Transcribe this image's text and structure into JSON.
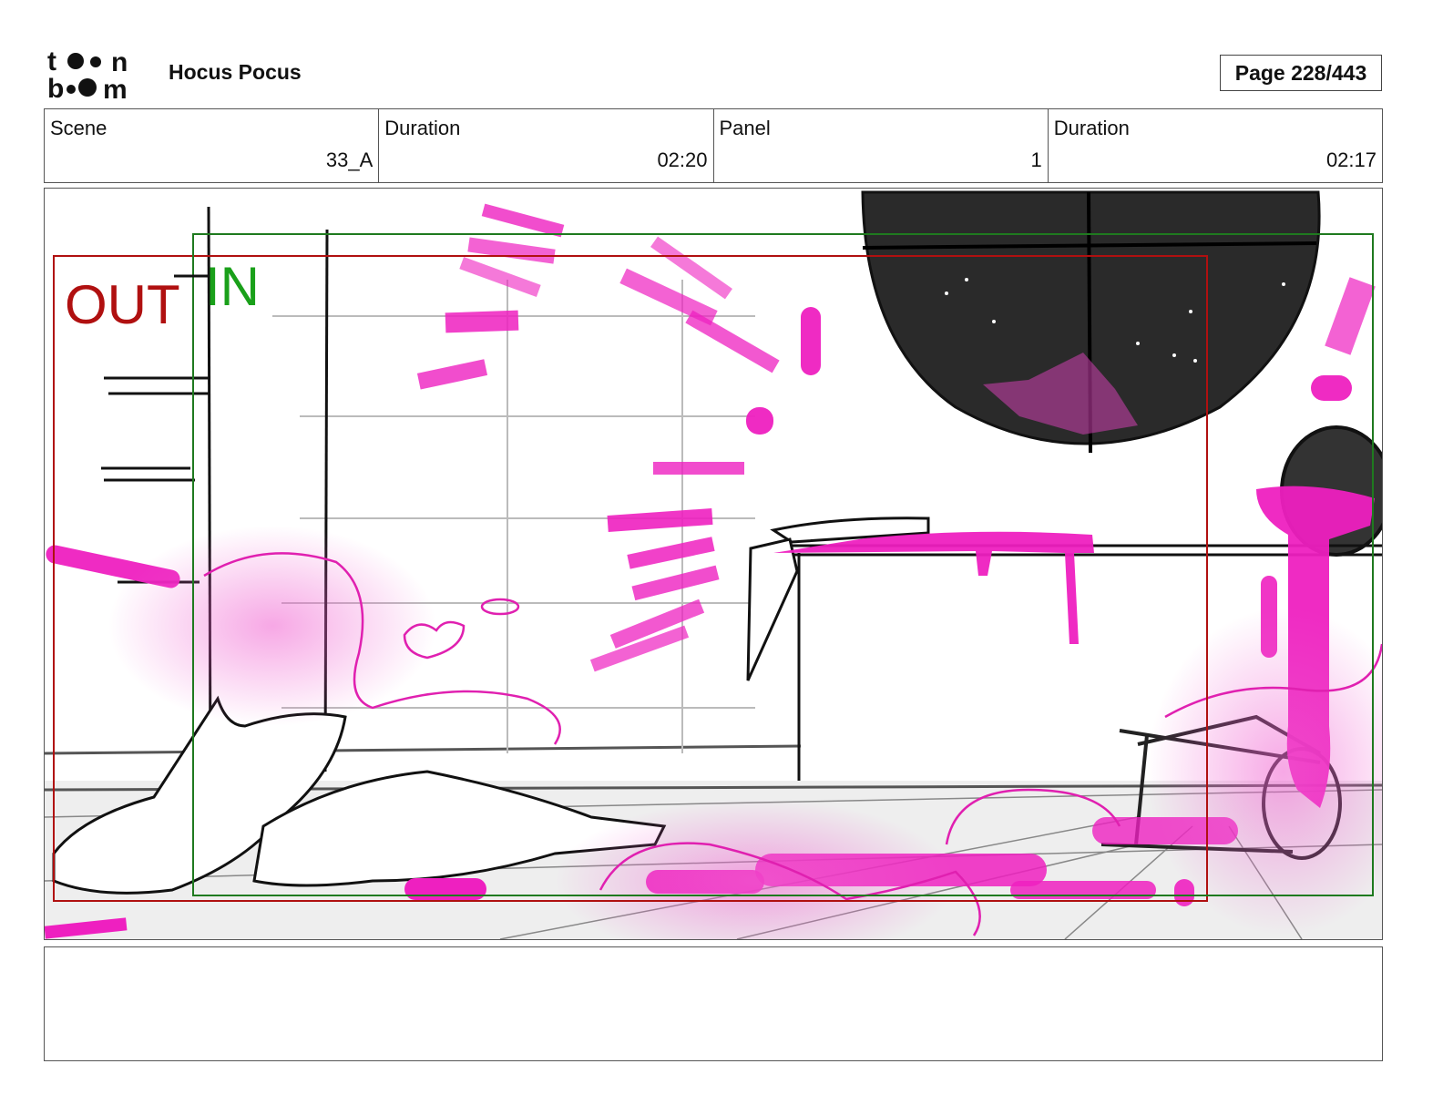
{
  "header": {
    "logo_text": [
      "toon",
      "boom"
    ],
    "project_title": "Hocus Pocus",
    "page_label": "Page 228/443"
  },
  "info": {
    "scene_label": "Scene",
    "scene_value": "33_A",
    "scene_duration_label": "Duration",
    "scene_duration_value": "02:20",
    "panel_label": "Panel",
    "panel_value": "1",
    "panel_duration_label": "Duration",
    "panel_duration_value": "02:17"
  },
  "panel_image": {
    "out_label": "OUT",
    "in_label": "IN",
    "colors": {
      "out_frame": "#b01010",
      "in_frame": "#1f7a1f",
      "magenta": "#ee20c0",
      "window": "#2a2a2a"
    }
  },
  "notes": {
    "text": ""
  }
}
